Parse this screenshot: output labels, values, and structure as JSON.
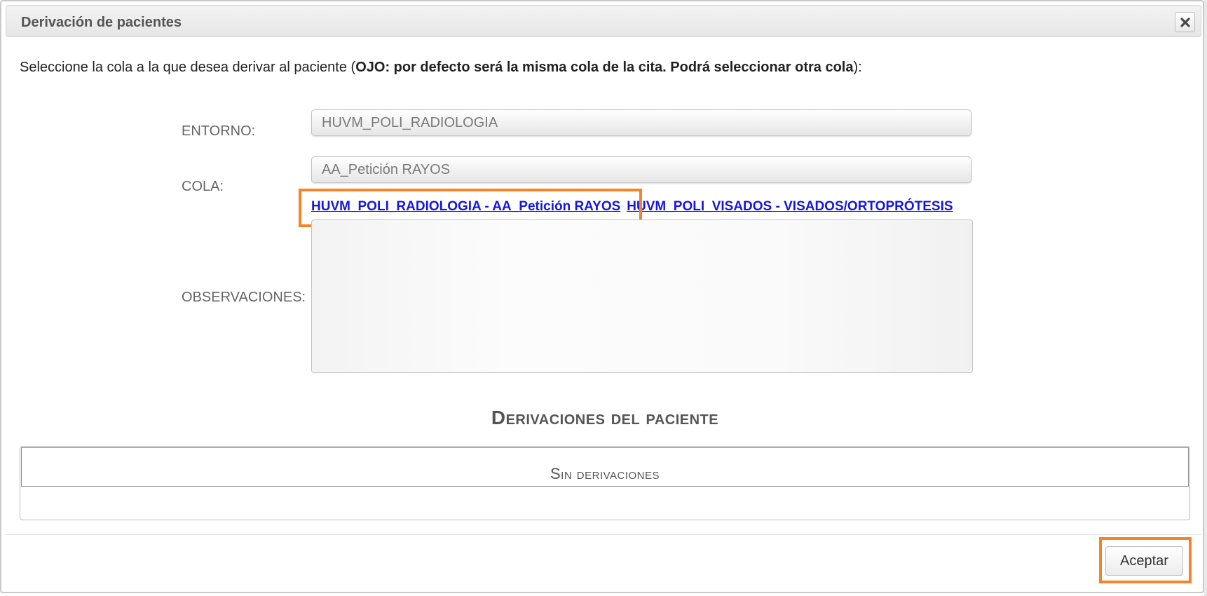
{
  "dialog": {
    "title": "Derivación de pacientes",
    "close_icon": "close-icon"
  },
  "instruction": {
    "prefix": "Seleccione la cola a la que desea derivar al paciente (",
    "bold": "OJO: por defecto será la misma cola de la cita. Podrá seleccionar otra cola",
    "suffix": "):"
  },
  "form": {
    "entorno_label": "ENTORNO:",
    "entorno_value": "HUVM_POLI_RADIOLOGIA",
    "cola_label": "COLA:",
    "cola_value": "AA_Petición RAYOS",
    "queue_options": [
      "HUVM_POLI_RADIOLOGIA - AA_Petición RAYOS",
      "HUVM_POLI_VISADOS - VISADOS/ORTOPRÓTESIS"
    ],
    "observaciones_label": "OBSERVACIONES:",
    "observaciones_value": ""
  },
  "derivations": {
    "title": "Derivaciones del paciente",
    "empty_text": "Sin derivaciones"
  },
  "footer": {
    "accept_label": "Aceptar"
  },
  "colors": {
    "highlight": "#f5832a",
    "link": "#1515e6"
  }
}
